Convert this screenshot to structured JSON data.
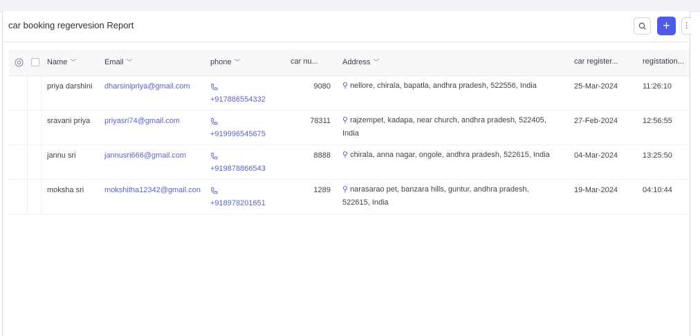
{
  "report": {
    "title": "car booking regervesion Report",
    "add_label": "+",
    "more_label": "⋮"
  },
  "columns": {
    "name": "Name",
    "email": "Email",
    "phone": "phone",
    "car_number": "car nu...",
    "address": "Address",
    "registered_date": "car register...",
    "registration_time": "registation..."
  },
  "rows": [
    {
      "name": "priya darshini",
      "email": "dharsinipriya@gmail.com",
      "phone": "+917886554332",
      "car_number": "9080",
      "address_line1": "nellore, chirala, bapatla, andhra pradesh, 522556, India",
      "address_line2": "",
      "date": "25-Mar-2024",
      "time": "11:26:10"
    },
    {
      "name": "sravani priya",
      "email": "priyasri74@gmail.com",
      "phone": "+919996545675",
      "car_number": "78311",
      "address_line1": "rajzempet, kadapa, near church, andhra pradesh, 522405,",
      "address_line2": "India",
      "date": "27-Feb-2024",
      "time": "12:56:55"
    },
    {
      "name": "jannu sri",
      "email": "jannusri666@gmail.com",
      "phone": "+919878866543",
      "car_number": "8888",
      "address_line1": "chirala, anna nagar, ongole, andhra pradesh, 522615, India",
      "address_line2": "",
      "date": "04-Mar-2024",
      "time": "13:25:50"
    },
    {
      "name": "moksha sri",
      "email": "mokshitha12342@gmail.con",
      "phone": "+918978201651",
      "car_number": "1289",
      "address_line1": "narasarao pet, banzara hills, guntur, andhra pradesh,",
      "address_line2": "522615, India",
      "date": "19-Mar-2024",
      "time": "04:10:44"
    }
  ],
  "colors": {
    "accent": "#4f5be8",
    "link": "#5a63c7"
  }
}
